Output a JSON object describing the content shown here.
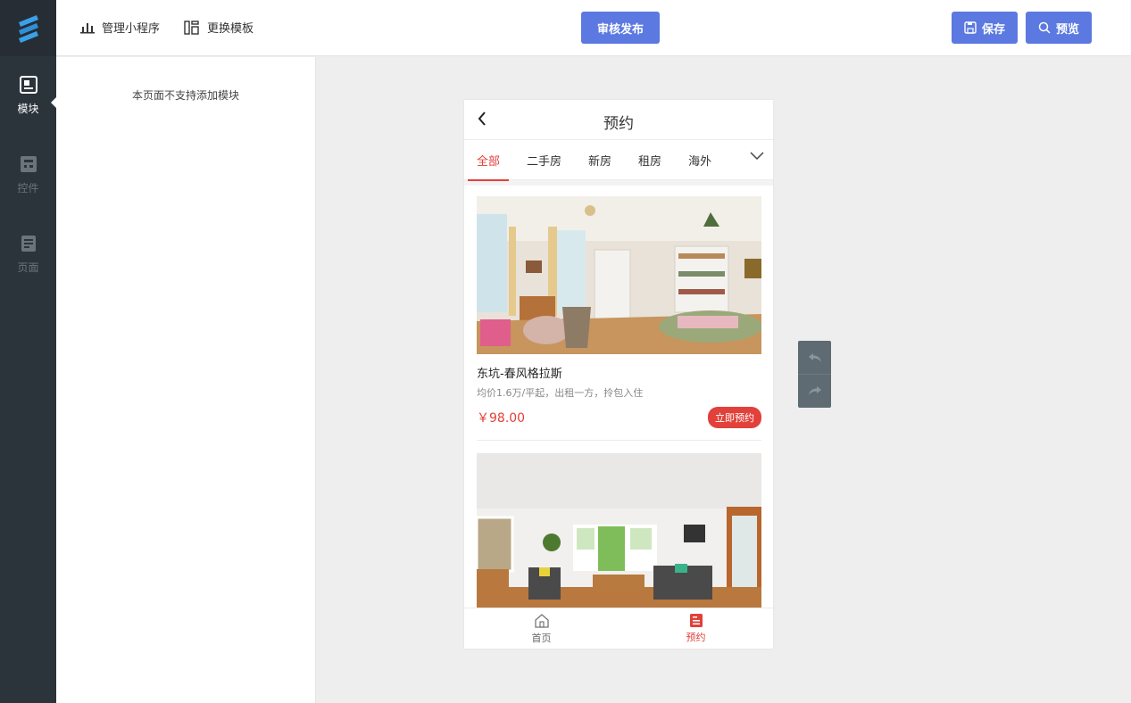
{
  "rail": {
    "items": [
      {
        "label": "模块",
        "icon": "module-icon",
        "active": true
      },
      {
        "label": "控件",
        "icon": "widget-icon",
        "active": false
      },
      {
        "label": "页面",
        "icon": "page-icon",
        "active": false
      }
    ]
  },
  "topbar": {
    "manage_label": "管理小程序",
    "template_label": "更换模板",
    "publish_label": "审核发布",
    "save_label": "保存",
    "preview_label": "预览"
  },
  "panel": {
    "note": "本页面不支持添加模块"
  },
  "phone": {
    "title": "预约",
    "tabs": [
      "全部",
      "二手房",
      "新房",
      "租房",
      "海外"
    ],
    "active_tab": "全部",
    "cards": [
      {
        "title": "东坑-春风格拉斯",
        "desc": "均价1.6万/平起，出租一方，拎包入住",
        "price": "￥98.00",
        "button": "立即预约"
      }
    ],
    "bottom_nav": [
      {
        "label": "首页",
        "icon": "home-icon",
        "active": false
      },
      {
        "label": "预约",
        "icon": "booking-icon",
        "active": true
      }
    ]
  },
  "colors": {
    "accent": "#5b79e0",
    "rail_bg": "#2b333b",
    "red": "#e1413a"
  }
}
